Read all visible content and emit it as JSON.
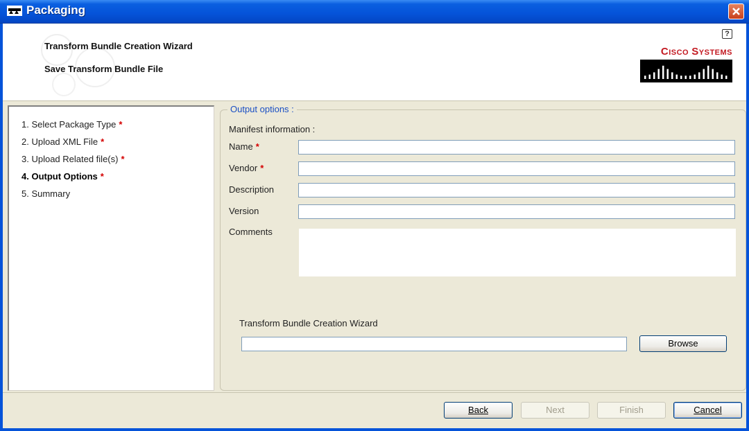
{
  "window": {
    "title": "Packaging"
  },
  "header": {
    "wizard_title": "Transform Bundle Creation Wizard",
    "page_title": "Save Transform Bundle File",
    "help": "?",
    "brand": "Cisco Systems"
  },
  "steps": [
    {
      "label": "1. Select Package Type",
      "required": "*"
    },
    {
      "label": "2. Upload XML File",
      "required": "*"
    },
    {
      "label": "3. Upload Related file(s)",
      "required": "*"
    },
    {
      "label": "4. Output Options",
      "required": "*"
    },
    {
      "label": "5. Summary"
    }
  ],
  "output": {
    "group_title": "Output options :",
    "manifest_label": "Manifest information :",
    "fields": {
      "name": {
        "label": "Name",
        "required": "*",
        "value": ""
      },
      "vendor": {
        "label": "Vendor",
        "required": "*",
        "value": ""
      },
      "description": {
        "label": "Description",
        "value": ""
      },
      "version": {
        "label": "Version",
        "value": ""
      },
      "comments": {
        "label": "Comments",
        "value": ""
      }
    },
    "file_label": "Transform Bundle Creation Wizard",
    "file_value": "",
    "browse": "Browse"
  },
  "footer": {
    "back": "Back",
    "next": "Next",
    "finish": "Finish",
    "cancel": "Cancel"
  },
  "colors": {
    "titlebar": "#0553d9",
    "required": "#d40000",
    "group_title": "#1a4fc4",
    "brand_red": "#c31a22"
  }
}
